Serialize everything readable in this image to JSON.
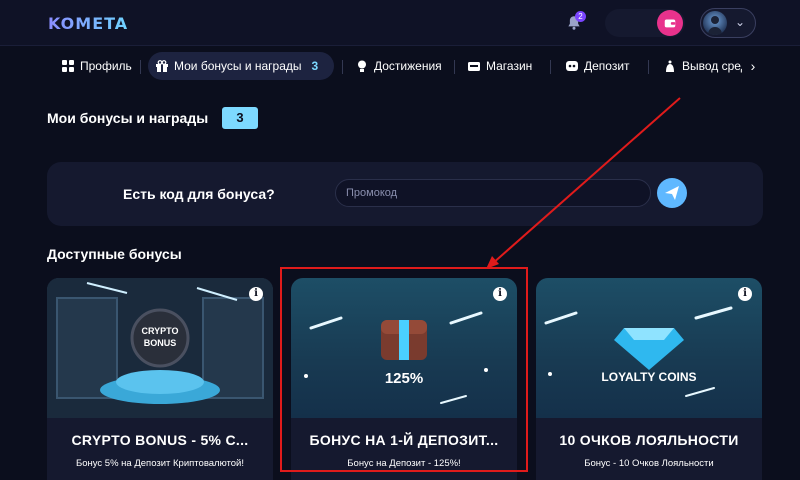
{
  "header": {
    "logo": "KOMETA",
    "notifications_count": "2"
  },
  "tabs": [
    {
      "label": "Профиль",
      "icon": "grid-icon"
    },
    {
      "label": "Мои бонусы и награды",
      "count": "3",
      "icon": "gift-icon"
    },
    {
      "label": "Достижения",
      "icon": "trophy-icon"
    },
    {
      "label": "Магазин",
      "icon": "shop-icon"
    },
    {
      "label": "Депозит",
      "icon": "deposit-icon"
    },
    {
      "label": "Вывод сред",
      "icon": "bag-icon"
    }
  ],
  "page": {
    "title": "Мои бонусы и награды",
    "count": "3"
  },
  "promo": {
    "label": "Есть код для бонуса?",
    "placeholder": "Промокод"
  },
  "available": {
    "title": "Доступные бонусы"
  },
  "cards": [
    {
      "image_text_1": "CRYPTO",
      "image_text_2": "BONUS",
      "title": "CRYPTO BONUS - 5% C...",
      "description": "Бонус 5% на Депозит Криптовалютой!"
    },
    {
      "image_text": "125%",
      "title": "БОНУС НА 1-Й ДЕПОЗИТ...",
      "description": "Бонус на Депозит - 125%!"
    },
    {
      "image_text": "LOYALTY COINS",
      "title": "10 ОЧКОВ ЛОЯЛЬНОСТИ",
      "description": "Бонус - 10 Очков Лояльности"
    }
  ],
  "colors": {
    "background": "#0b0e1d",
    "card": "#15192f",
    "accent": "#7dd9ff",
    "annotation": "#e01b1b",
    "wallet": "#e8328c"
  }
}
